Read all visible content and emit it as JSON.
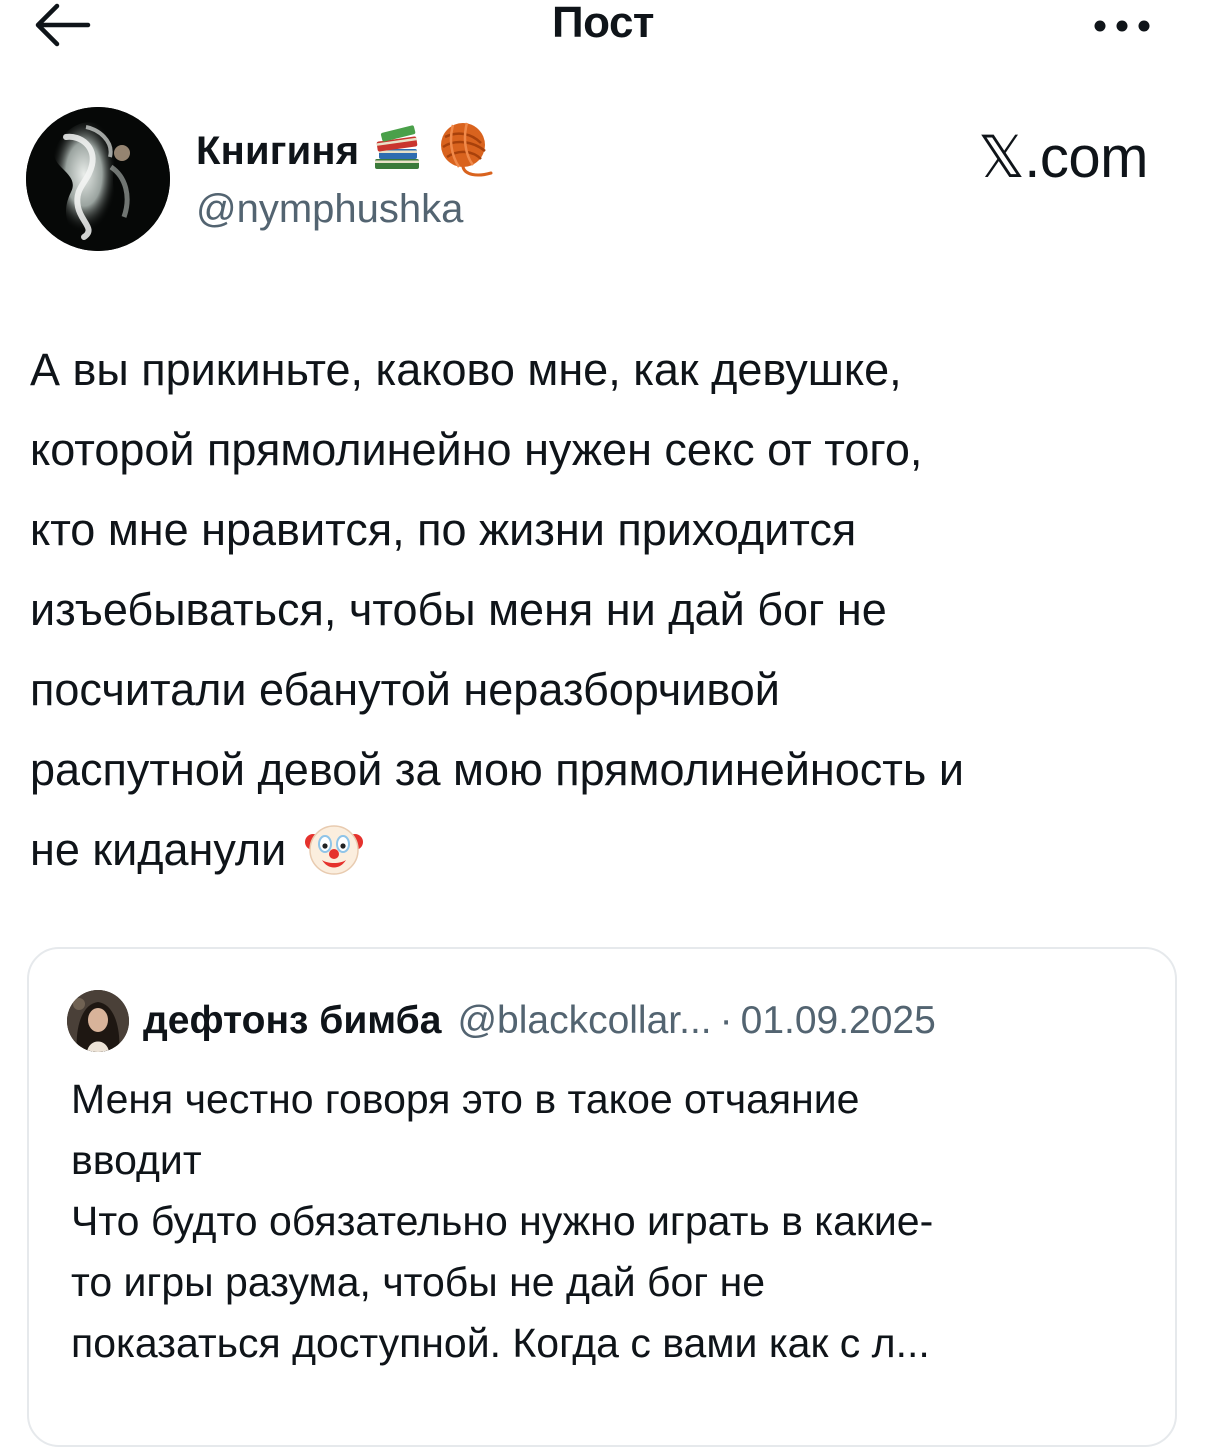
{
  "header": {
    "title": "Пост",
    "back_icon": "arrow-left-icon",
    "more_icon": "more-horizontal-icon"
  },
  "author": {
    "display_name": "Книгиня",
    "badges": [
      "books-emoji-icon",
      "yarn-emoji-icon"
    ],
    "handle": "@nymphushka"
  },
  "watermark": {
    "text": "𝕏.com"
  },
  "post": {
    "lines": [
      "А вы прикиньте, каково мне, как девушке,",
      "которой прямолинейно нужен секс от того,",
      "кто мне нравится, по жизни приходится",
      "изъебываться, чтобы меня ни дай бог не",
      "посчитали ебанутой неразборчивой",
      "распутной девой за мою прямолинейность и",
      "не киданули"
    ],
    "trailing_emoji": "clown-face-emoji-icon"
  },
  "quote": {
    "name": "дефтонз бимба",
    "handle": "@blackcollar...",
    "separator": "·",
    "date": "01.09.2025",
    "lines": [
      "Меня честно говоря это в такое отчаяние",
      "вводит",
      "Что будто обязательно нужно играть в какие-",
      "то игры разума, чтобы не дай бог не",
      "показаться доступной. Когда с вами как с л..."
    ]
  },
  "colors": {
    "text": "#0f1419",
    "secondary": "#536471",
    "border": "#e6e9ec"
  }
}
